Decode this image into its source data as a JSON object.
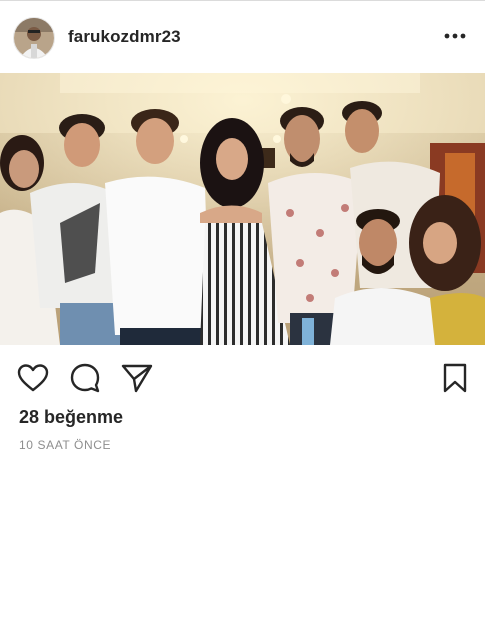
{
  "post": {
    "username": "farukozdmr23",
    "likes_text": "28 beğenme",
    "time_text": "10 SAAT ÖNCE"
  },
  "icons": {
    "more": "more-dots-icon",
    "like": "heart-icon",
    "comment": "comment-bubble-icon",
    "share": "paper-plane-icon",
    "save": "bookmark-icon"
  }
}
